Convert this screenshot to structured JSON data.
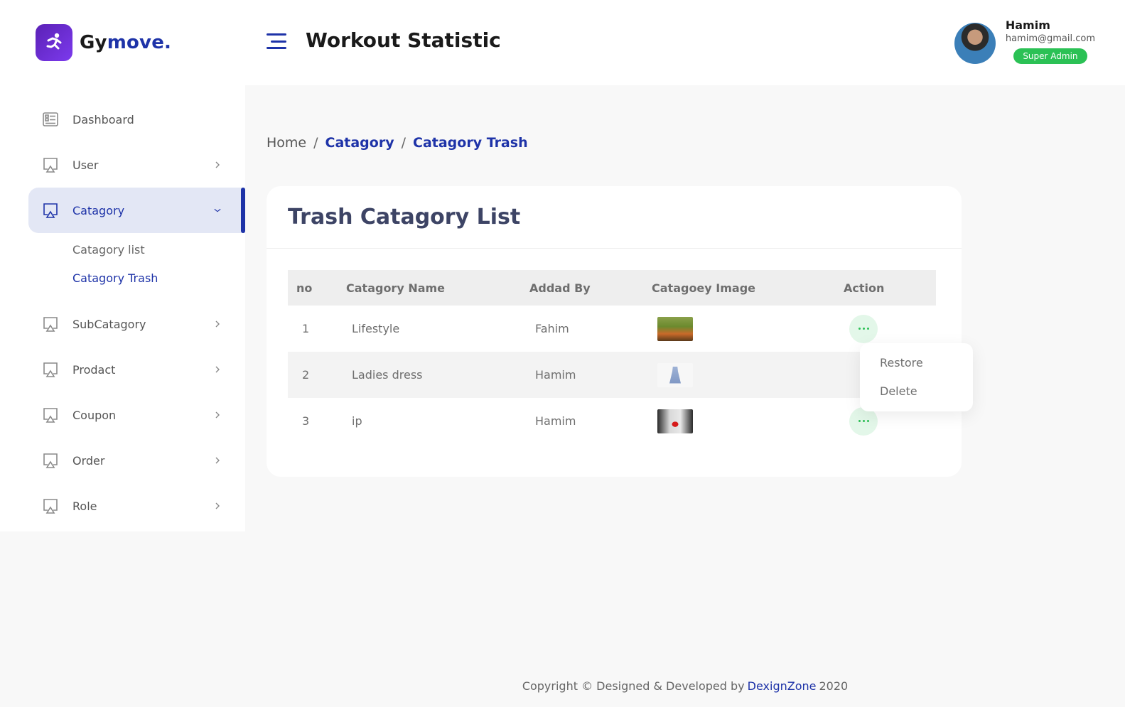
{
  "brand": {
    "name_prefix": "Gy",
    "name_accent": "move."
  },
  "header": {
    "title": "Workout Statistic",
    "user": {
      "name": "Hamim",
      "email": "hamim@gmail.com",
      "role": "Super Admin"
    }
  },
  "sidebar": {
    "items": [
      {
        "label": "Dashboard"
      },
      {
        "label": "User"
      },
      {
        "label": "Catagory"
      },
      {
        "label": "SubCatagory"
      },
      {
        "label": "Prodact"
      },
      {
        "label": "Coupon"
      },
      {
        "label": "Order"
      },
      {
        "label": "Role"
      }
    ],
    "submenu": [
      {
        "label": "Catagory list"
      },
      {
        "label": "Catagory Trash"
      }
    ]
  },
  "breadcrumb": {
    "home": "Home",
    "sep": "/",
    "level1": "Catagory",
    "level2": "Catagory Trash"
  },
  "card": {
    "title": "Trash Catagory List",
    "columns": {
      "no": "no",
      "name": "Catagory Name",
      "added_by": "Addad By",
      "image": "Catagoey Image",
      "action": "Action"
    },
    "rows": [
      {
        "no": "1",
        "name": "Lifestyle",
        "added_by": "Fahim"
      },
      {
        "no": "2",
        "name": "Ladies dress",
        "added_by": "Hamim"
      },
      {
        "no": "3",
        "name": "ip",
        "added_by": "Hamim"
      }
    ]
  },
  "dropdown": {
    "restore": "Restore",
    "delete": "Delete"
  },
  "footer": {
    "prefix": "Copyright © Designed & Developed by",
    "brand": "DexignZone",
    "year": "2020"
  },
  "colors": {
    "primary": "#1e33a8",
    "success": "#2bc155",
    "active_bg": "#e3e7f5"
  }
}
